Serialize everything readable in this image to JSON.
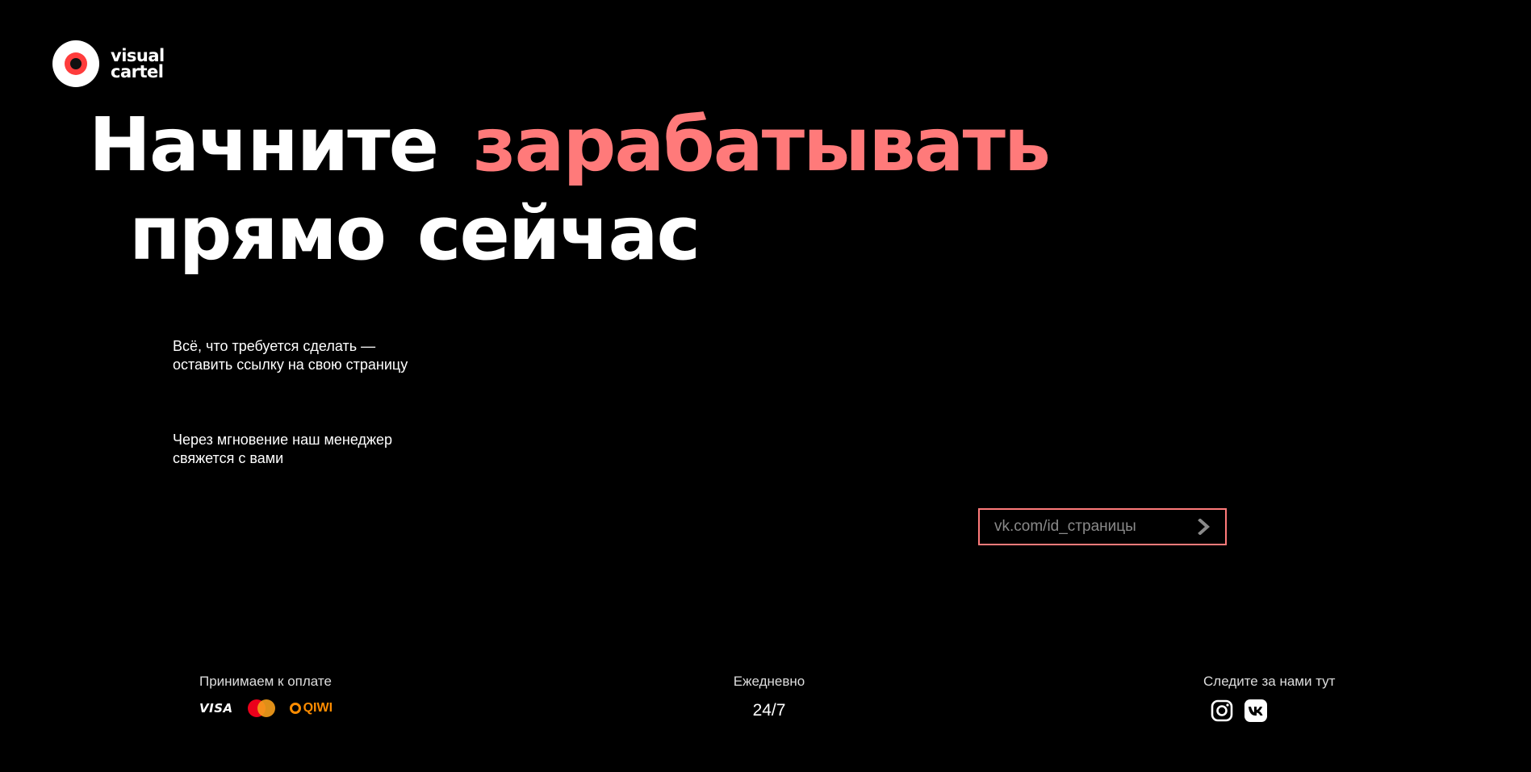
{
  "brand": {
    "logo_line1": "visual",
    "logo_line2": "cartel",
    "accent_color": "#ff7a7a"
  },
  "hero": {
    "line1_word1": "Начните",
    "line1_word2_accent": "зарабатывать",
    "line2_word1": "прямо",
    "line2_word2": "сейчас"
  },
  "description": {
    "step1_line1": "Всё, что требуется сделать —",
    "step1_line2": "оставить ссылку на свою страницу",
    "step2_line1": "Через мгновение наш менеджер",
    "step2_line2": "свяжется с вами"
  },
  "form": {
    "placeholder": "vk.com/id_страницы",
    "value": "",
    "submit_icon": "chevron-right-icon"
  },
  "footer": {
    "payment_label": "Принимаем к оплате",
    "payment_methods": [
      "VISA",
      "mastercard-icon",
      "QIWI"
    ],
    "visa_text": "VISA",
    "qiwi_text": "QIWI",
    "daily_label": "Ежедневно",
    "hours": "24/7",
    "social_label": "Следите за нами тут",
    "social_icons": [
      "instagram-icon",
      "vk-icon"
    ]
  }
}
